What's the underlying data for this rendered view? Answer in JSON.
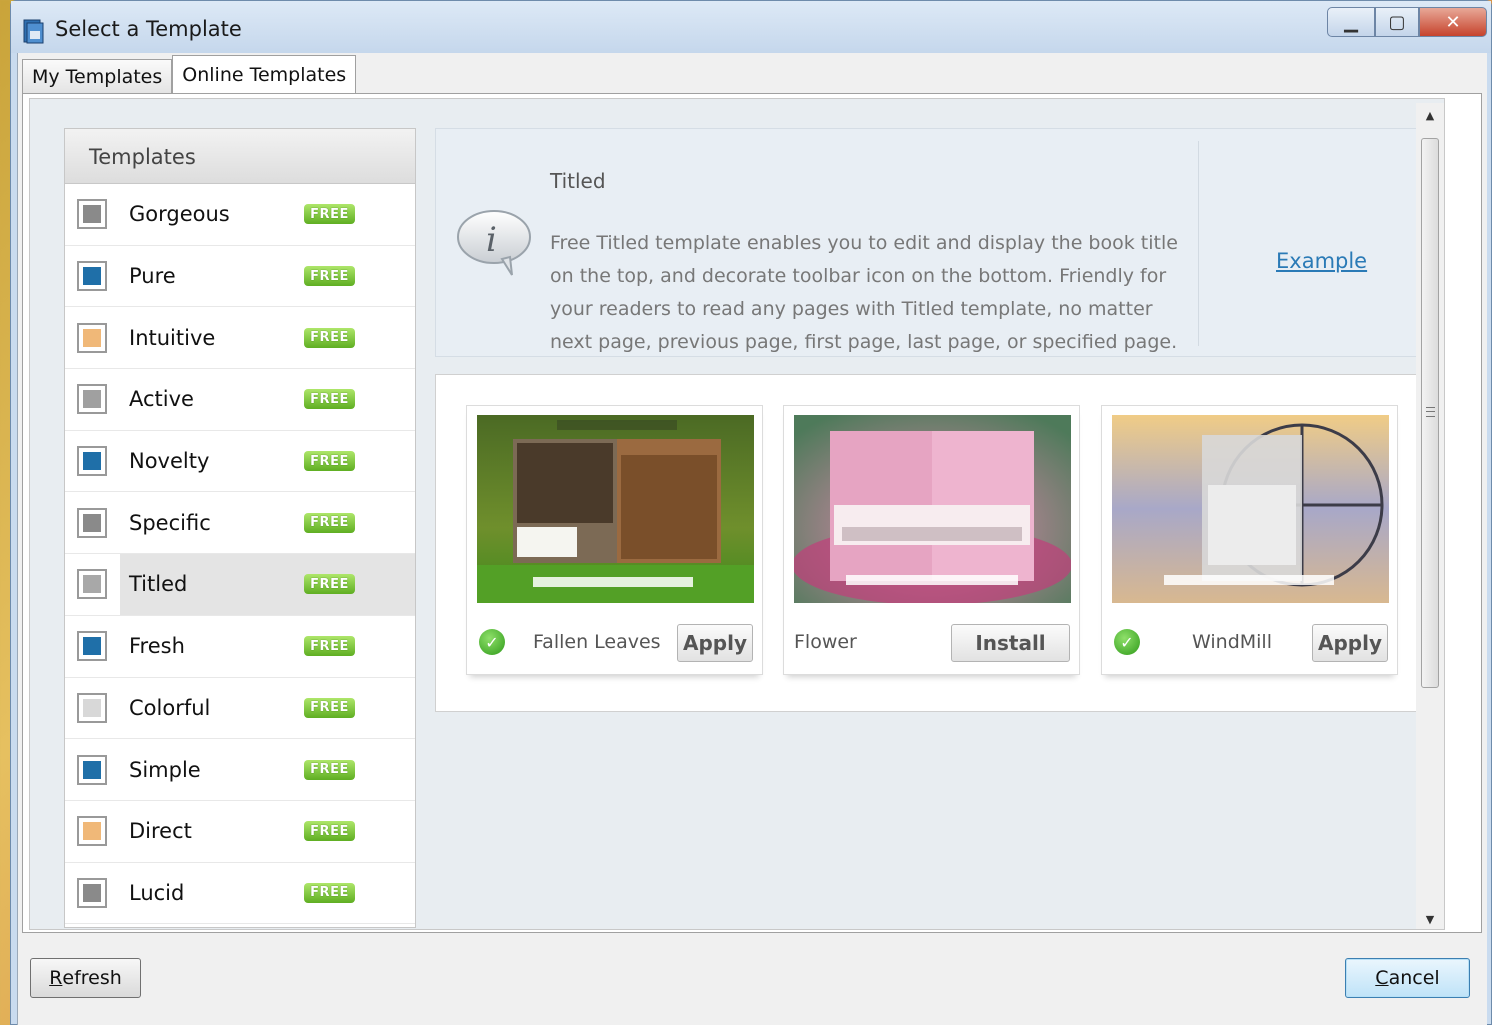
{
  "window": {
    "title": "Select a Template"
  },
  "tabs": [
    {
      "label": "My Templates",
      "active": false
    },
    {
      "label": "Online Templates",
      "active": true
    }
  ],
  "sidebar": {
    "header": "Templates",
    "badge": "FREE",
    "items": [
      {
        "label": "Gorgeous",
        "icon": "template-gray-icon",
        "color": "#8a8a8a"
      },
      {
        "label": "Pure",
        "icon": "template-blue-icon",
        "color": "#1f6fa8"
      },
      {
        "label": "Intuitive",
        "icon": "template-orange-icon",
        "color": "#f0b878"
      },
      {
        "label": "Active",
        "icon": "template-gray-icon",
        "color": "#a0a0a0"
      },
      {
        "label": "Novelty",
        "icon": "template-blue-icon",
        "color": "#1f6fa8"
      },
      {
        "label": "Specific",
        "icon": "template-gray-icon",
        "color": "#8a8a8a"
      },
      {
        "label": "Titled",
        "icon": "template-gray-icon",
        "color": "#a8a8a8",
        "selected": true
      },
      {
        "label": "Fresh",
        "icon": "template-blue-icon",
        "color": "#1f6fa8"
      },
      {
        "label": "Colorful",
        "icon": "template-light-icon",
        "color": "#d8d8d8"
      },
      {
        "label": "Simple",
        "icon": "template-blue-icon",
        "color": "#1f6fa8"
      },
      {
        "label": "Direct",
        "icon": "template-orange-icon",
        "color": "#f0b878"
      },
      {
        "label": "Lucid",
        "icon": "template-gray-icon",
        "color": "#8a8a8a"
      }
    ]
  },
  "info": {
    "title": "Titled",
    "description": "Free Titled template enables you to edit and display the book title on the top, and decorate toolbar icon on the bottom. Friendly for your readers to read any pages with Titled template, no matter next page, previous page, first page, last page, or specified page.",
    "example_link": "Example",
    "icon": "info-speech-bubble-icon"
  },
  "cards": [
    {
      "name": "Fallen Leaves",
      "button": "Apply",
      "installed": true
    },
    {
      "name": "Flower",
      "button": "Install",
      "installed": false
    },
    {
      "name": "WindMill",
      "button": "Apply",
      "installed": true
    }
  ],
  "buttons": {
    "refresh": {
      "first": "R",
      "rest": "efresh"
    },
    "cancel": {
      "first": "C",
      "rest": "ancel"
    }
  },
  "colors": {
    "accent_link": "#2a7ab6",
    "free_badge": "#5fae22",
    "check_green": "#2e9a19"
  }
}
